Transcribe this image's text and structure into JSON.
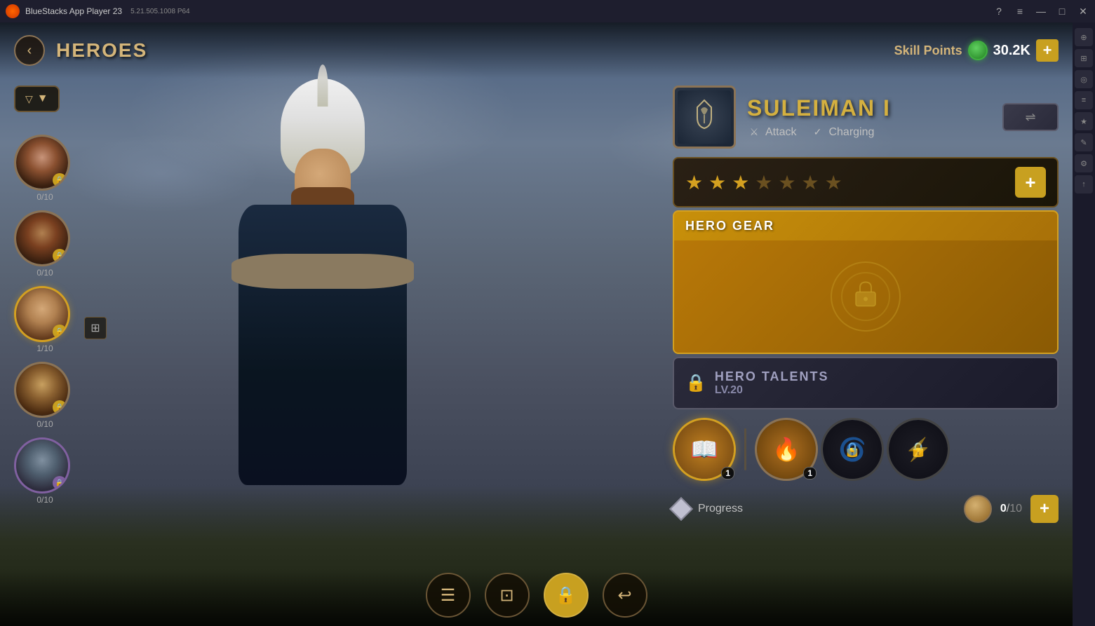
{
  "app": {
    "title": "BlueStacks App Player 23",
    "version": "5.21.505.1008 P64"
  },
  "title_bar": {
    "controls": [
      "?",
      "≡",
      "—",
      "□",
      "✕"
    ]
  },
  "top_nav": {
    "back_label": "‹",
    "title": "HEROES",
    "skill_points_label": "Skill Points",
    "skill_points_value": "30.2K",
    "skill_plus": "+"
  },
  "filter": {
    "icon": "▼",
    "label": "▼"
  },
  "hero_list": [
    {
      "id": 1,
      "progress": "0/10",
      "locked": true
    },
    {
      "id": 2,
      "progress": "0/10",
      "locked": true
    },
    {
      "id": 3,
      "progress": "1/10",
      "locked": true,
      "active": true
    },
    {
      "id": 4,
      "progress": "0/10",
      "locked": true
    },
    {
      "id": 5,
      "progress": "0/10",
      "locked": true,
      "purple": true
    }
  ],
  "hero_detail": {
    "name": "SULEIMAN I",
    "type1": "Attack",
    "type2": "Charging",
    "stars": [
      true,
      true,
      true,
      false,
      false,
      false,
      false
    ],
    "stars_add": "+",
    "gear_section": {
      "title": "HERO GEAR"
    },
    "talents_section": {
      "title": "HERO TALENTS",
      "level": "LV.20"
    },
    "skills": [
      {
        "active": true,
        "badge": "1",
        "locked": false
      },
      {
        "active": false,
        "badge": "1",
        "locked": false
      },
      {
        "active": false,
        "badge": null,
        "locked": true
      },
      {
        "active": false,
        "badge": null,
        "locked": true
      }
    ],
    "progress": {
      "label": "Progress",
      "current": "0",
      "total": "10",
      "add": "+"
    }
  },
  "bottom_nav": [
    {
      "icon": "☰",
      "label": "list",
      "active": false
    },
    {
      "icon": "⊡",
      "label": "select",
      "active": false
    },
    {
      "icon": "🔒",
      "label": "lock",
      "active": true
    },
    {
      "icon": "↩",
      "label": "back",
      "active": false
    }
  ],
  "right_sidebar_tools": [
    "?",
    "⊞",
    "◎",
    "≡",
    "★",
    "✎"
  ],
  "colors": {
    "gold": "#d4b040",
    "dark_gold": "#8B7355",
    "accent_orange": "#c8a020",
    "purple": "#8060a0"
  }
}
